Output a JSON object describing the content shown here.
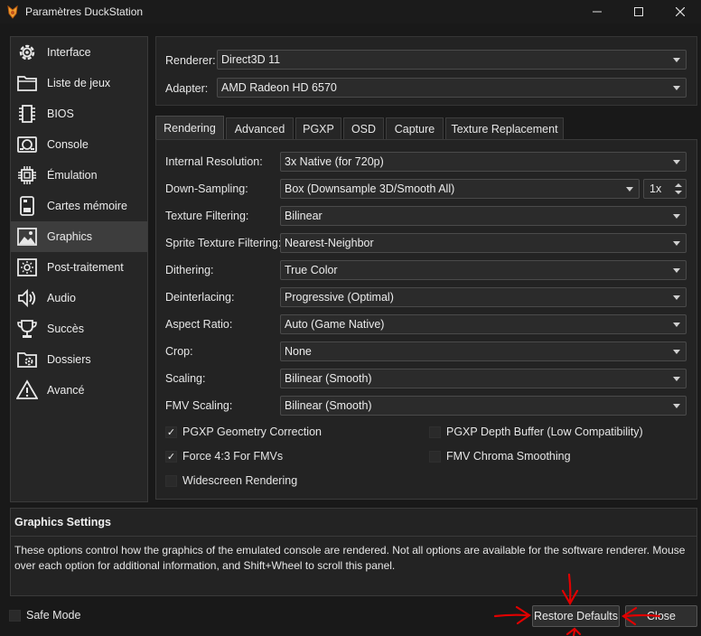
{
  "window": {
    "title": "Paramètres DuckStation",
    "app_icon": "duck-flame-icon",
    "controls": [
      "minimize-icon",
      "maximize-icon",
      "close-icon"
    ]
  },
  "sidebar": {
    "items": [
      {
        "label": "Interface",
        "icon": "gear-icon"
      },
      {
        "label": "Liste de jeux",
        "icon": "folder-icon"
      },
      {
        "label": "BIOS",
        "icon": "chip-icon"
      },
      {
        "label": "Console",
        "icon": "console-icon"
      },
      {
        "label": "Émulation",
        "icon": "cpu-icon"
      },
      {
        "label": "Cartes mémoire",
        "icon": "memory-card-icon"
      },
      {
        "label": "Graphics",
        "icon": "image-icon"
      },
      {
        "label": "Post-traitement",
        "icon": "sun-icon"
      },
      {
        "label": "Audio",
        "icon": "speaker-icon"
      },
      {
        "label": "Succès",
        "icon": "trophy-icon"
      },
      {
        "label": "Dossiers",
        "icon": "folder-settings-icon"
      },
      {
        "label": "Avancé",
        "icon": "warning-icon"
      }
    ],
    "selected": "Graphics"
  },
  "device": {
    "renderer_label": "Renderer:",
    "renderer_value": "Direct3D 11",
    "adapter_label": "Adapter:",
    "adapter_value": "AMD Radeon HD 6570"
  },
  "tabs": [
    "Rendering",
    "Advanced",
    "PGXP",
    "OSD",
    "Capture",
    "Texture Replacement"
  ],
  "active_tab": "Rendering",
  "rendering": {
    "rows": [
      {
        "label": "Internal Resolution:",
        "value": "3x Native (for 720p)"
      },
      {
        "label": "Down-Sampling:",
        "value": "Box (Downsample 3D/Smooth All)"
      },
      {
        "label": "Texture Filtering:",
        "value": "Bilinear"
      },
      {
        "label": "Sprite Texture Filtering:",
        "value": "Nearest-Neighbor"
      },
      {
        "label": "Dithering:",
        "value": "True Color"
      },
      {
        "label": "Deinterlacing:",
        "value": "Progressive (Optimal)"
      },
      {
        "label": "Aspect Ratio:",
        "value": "Auto (Game Native)"
      },
      {
        "label": "Crop:",
        "value": "None"
      },
      {
        "label": "Scaling:",
        "value": "Bilinear (Smooth)"
      },
      {
        "label": "FMV Scaling:",
        "value": "Bilinear (Smooth)"
      }
    ],
    "downsample_factor": "1x",
    "checks": [
      {
        "label": "PGXP Geometry Correction",
        "checked": true
      },
      {
        "label": "PGXP Depth Buffer (Low Compatibility)",
        "checked": false
      },
      {
        "label": "Force 4:3 For FMVs",
        "checked": true
      },
      {
        "label": "FMV Chroma Smoothing",
        "checked": false
      },
      {
        "label": "Widescreen Rendering",
        "checked": false
      }
    ]
  },
  "info": {
    "title": "Graphics Settings",
    "text": "These options control how the graphics of the emulated console are rendered. Not all options are available for the software renderer. Mouse over each option for additional information, and Shift+Wheel to scroll this panel."
  },
  "footer": {
    "safe_mode_label": "Safe Mode",
    "safe_mode_checked": false,
    "restore_label": "Restore Defaults",
    "close_label": "Close"
  },
  "colors": {
    "background": "#191919",
    "panel": "#232323",
    "annotation": "#e00000"
  }
}
